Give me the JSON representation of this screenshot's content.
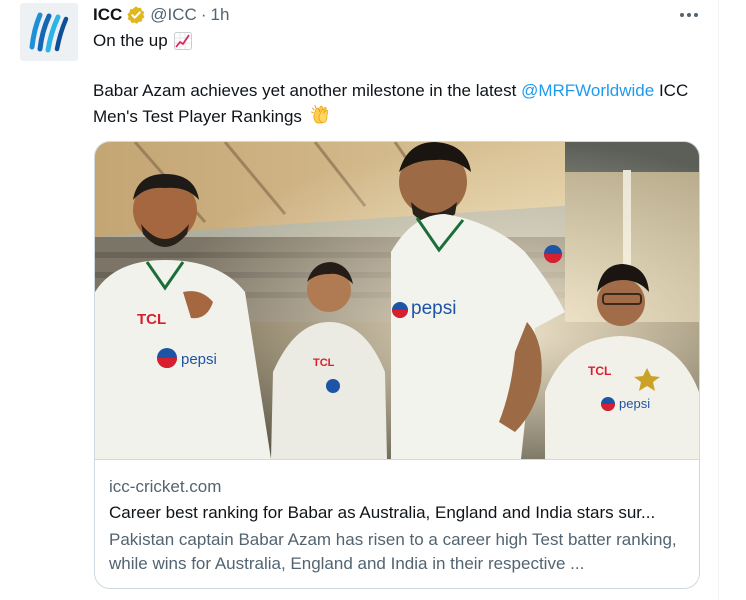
{
  "tweet": {
    "display_name": "ICC",
    "handle": "@ICC",
    "separator": "·",
    "time": "1h",
    "line1": "On the up",
    "body_before": "Babar Azam achieves yet another milestone in the latest ",
    "mention": "@MRFWorldwide",
    "body_after": " ICC Men's Test Player Rankings"
  },
  "card": {
    "domain": "icc-cricket.com",
    "title": "Career best ranking for Babar as Australia, England and India stars sur...",
    "description": "Pakistan captain Babar Azam has risen to a career high Test batter ranking, while wins for Australia, England and India in their respective ...",
    "image_texts": {
      "sponsor_tcl": "TCL",
      "sponsor_pepsi": "pepsi"
    }
  },
  "icons": {
    "avatar": "icc-logo-icon",
    "verified": "verified-badge-icon",
    "more": "more-options-icon",
    "chart": "chart-increasing-emoji-icon",
    "clap": "clapping-hands-emoji-icon"
  },
  "colors": {
    "link": "#1d9bf0",
    "secondary_text": "#536471",
    "verified_gold": "#e2b719",
    "card_border": "#cfd9de"
  }
}
